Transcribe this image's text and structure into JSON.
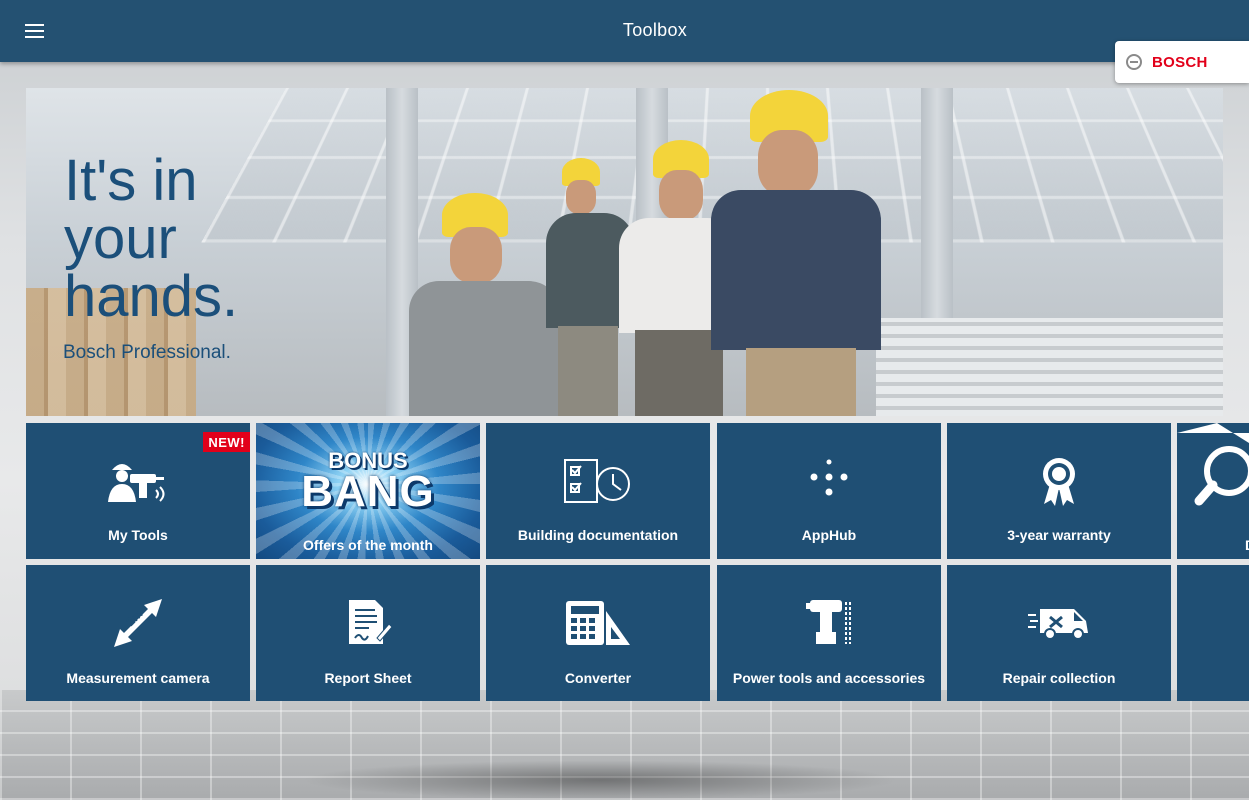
{
  "header": {
    "title": "Toolbox",
    "menu_icon": "hamburger-menu-icon",
    "brand": {
      "name": "BOSCH",
      "icon": "bosch-armature-logo-icon",
      "color": "#e2001a"
    },
    "background": "#245172"
  },
  "hero": {
    "headline_line1": "It's in",
    "headline_line2": "your",
    "headline_line3": "hands.",
    "subline": "Bosch Professional."
  },
  "tiles_row1": [
    {
      "label": "My Tools",
      "icon": "worker-with-drill-icon",
      "badge": "NEW!"
    },
    {
      "label": "Offers of the month",
      "icon": "bonus-bang-banner",
      "promo_line1": "BONUS",
      "promo_line2": "BANG"
    },
    {
      "label": "Building documentation",
      "icon": "checklist-clock-icon"
    },
    {
      "label": "AppHub",
      "icon": "dots-cross-icon"
    },
    {
      "label": "3-year warranty",
      "icon": "warranty-badge-icon"
    },
    {
      "label": "D",
      "icon": "magnifier-icon"
    }
  ],
  "tiles_row2": [
    {
      "label": "Measurement camera",
      "icon": "measuring-ruler-2m-icon"
    },
    {
      "label": "Report Sheet",
      "icon": "document-signature-icon"
    },
    {
      "label": "Converter",
      "icon": "calculator-set-square-icon"
    },
    {
      "label": "Power tools and accessories",
      "icon": "drill-accessories-icon"
    },
    {
      "label": "Repair collection",
      "icon": "delivery-van-icon"
    },
    {
      "label": "",
      "icon": ""
    }
  ],
  "colors": {
    "tile": "#1f4f74",
    "headline": "#1b4f7a",
    "badge": "#e2001a",
    "helmet": "#f3d43a"
  }
}
